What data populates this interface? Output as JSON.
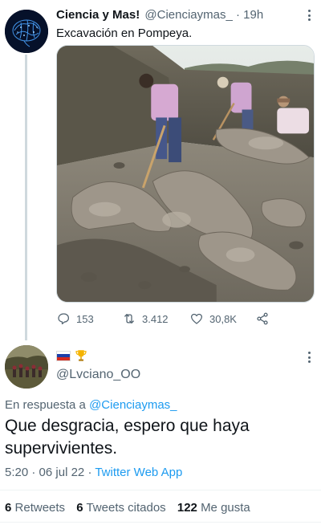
{
  "tweet": {
    "author_name": "Ciencia y Mas!",
    "author_handle": "@Cienciaymas_",
    "separator": "·",
    "time": "19h",
    "text": "Excavación en Pompeya.",
    "media_subject": "excavation-photo",
    "stats": {
      "replies": "153",
      "retweets": "3.412",
      "likes": "30,8K"
    },
    "icons": [
      "more-icon",
      "reply-icon",
      "retweet-icon",
      "like-icon",
      "share-icon"
    ]
  },
  "reply": {
    "badges": [
      "russia-flag-icon",
      "trophy-icon"
    ],
    "author_handle": "@Lvciano_OO",
    "reply_prefix": "En respuesta a",
    "reply_to": "@Cienciaymas_",
    "text": "Que desgracia, espero que haya supervivientes.",
    "time": "5:20",
    "separator": "·",
    "date": "06 jul 22",
    "separator2": "·",
    "client": "Twitter Web App",
    "stats": {
      "retweets_count": "6",
      "retweets_label": "Retweets",
      "quotes_count": "6",
      "quotes_label": "Tweets citados",
      "likes_count": "122",
      "likes_label": "Me gusta"
    }
  },
  "colors": {
    "link": "#1d9bf0",
    "secondary_text": "#536471",
    "primary_text": "#0f1419",
    "thread_line": "#cfd9de"
  }
}
